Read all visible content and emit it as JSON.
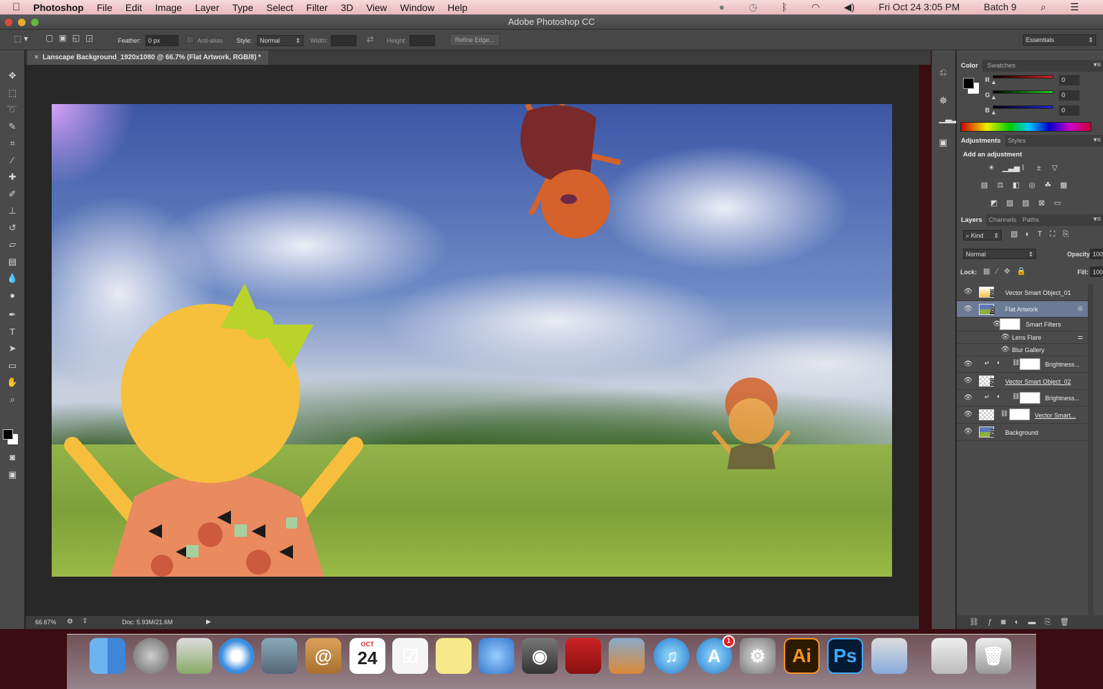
{
  "menubar": {
    "app": "Photoshop",
    "items": [
      "File",
      "Edit",
      "Image",
      "Layer",
      "Type",
      "Select",
      "Filter",
      "3D",
      "View",
      "Window",
      "Help"
    ],
    "clock": "Fri Oct 24  3:05 PM",
    "user": "Batch 9"
  },
  "window": {
    "title": "Adobe Photoshop CC"
  },
  "options": {
    "feather_label": "Feather:",
    "feather_value": "0 px",
    "antialias": "Anti-alias",
    "style_label": "Style:",
    "style_value": "Normal",
    "width_label": "Width:",
    "height_label": "Height:",
    "refine_edge": "Refine Edge...",
    "workspace": "Essentials"
  },
  "document": {
    "tab": "Lanscape Background_1920x1080 @ 66.7% (Flat Artwork, RGB/8) *",
    "close": "×"
  },
  "status": {
    "zoom": "66.67%",
    "doc": "Doc: 5.93M/21.6M"
  },
  "color_panel": {
    "tabs": [
      "Color",
      "Swatches"
    ],
    "channels": [
      {
        "label": "R",
        "value": "0",
        "color": "#e02020"
      },
      {
        "label": "G",
        "value": "0",
        "color": "#20d020"
      },
      {
        "label": "B",
        "value": "0",
        "color": "#2020e0"
      }
    ],
    "foreground": "#000000",
    "background": "#ffffff"
  },
  "adjustments_panel": {
    "tabs": [
      "Adjustments",
      "Styles"
    ],
    "heading": "Add an adjustment"
  },
  "layers_panel": {
    "tabs": [
      "Layers",
      "Channels",
      "Paths"
    ],
    "filter": "Kind",
    "blend_mode": "Normal",
    "opacity_label": "Opacity:",
    "opacity": "100%",
    "lock_label": "Lock:",
    "fill_label": "Fill:",
    "fill": "100%",
    "layers": [
      {
        "name": "Vector Smart Object_01"
      },
      {
        "name": "Flat Artwork",
        "selected": true
      },
      {
        "name": "Smart Filters"
      },
      {
        "name": "Lens Flare"
      },
      {
        "name": "Blur Gallery"
      },
      {
        "name": "Brightness..."
      },
      {
        "name": "Vector Smart Object_02"
      },
      {
        "name": "Brightness..."
      },
      {
        "name": "Vector Smart..."
      },
      {
        "name": "Background"
      }
    ]
  },
  "dock": {
    "calendar_month": "OCT",
    "calendar_day": "24",
    "appstore_badge": "1",
    "illustrator": "Ai",
    "photoshop": "Ps"
  }
}
